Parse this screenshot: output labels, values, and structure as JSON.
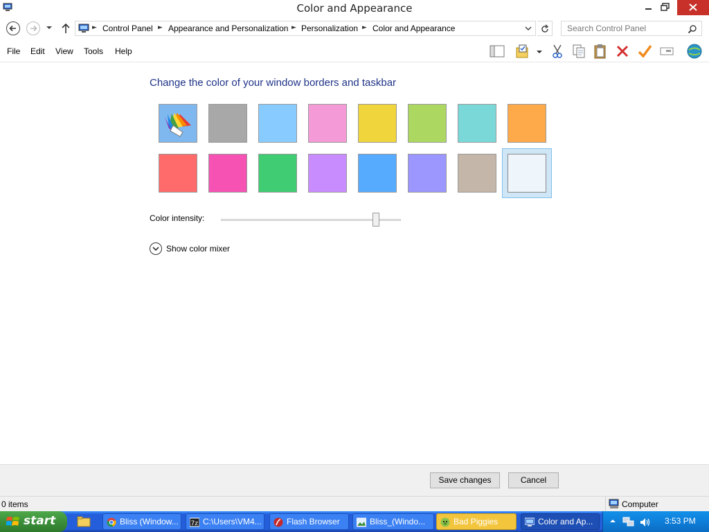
{
  "window": {
    "title": "Color and Appearance"
  },
  "address": {
    "breadcrumbs": [
      "Control Panel",
      "Appearance and Personalization",
      "Personalization",
      "Color and Appearance"
    ]
  },
  "search": {
    "placeholder": "Search Control Panel"
  },
  "menu": {
    "items": [
      "File",
      "Edit",
      "View",
      "Tools",
      "Help"
    ]
  },
  "toolbar": {
    "icons": [
      "layout-pane-icon",
      "folder-properties-icon",
      "cut-icon",
      "copy-icon",
      "paste-icon",
      "delete-icon",
      "check-icon",
      "rename-icon",
      "globe-icon"
    ]
  },
  "content": {
    "heading": "Change the color of your window borders and taskbar",
    "swatches_row1": [
      {
        "name": "automatic",
        "color": "#7fb7ef"
      },
      {
        "name": "gray",
        "color": "#a8a8a8"
      },
      {
        "name": "sky",
        "color": "#88ccff"
      },
      {
        "name": "pink",
        "color": "#f39ad7"
      },
      {
        "name": "yellow",
        "color": "#f0d53c"
      },
      {
        "name": "lime",
        "color": "#acd862"
      },
      {
        "name": "teal",
        "color": "#7ad9d8"
      },
      {
        "name": "orange",
        "color": "#ffaa4a"
      }
    ],
    "swatches_row2": [
      {
        "name": "red",
        "color": "#ff6b6b"
      },
      {
        "name": "magenta",
        "color": "#f552b3"
      },
      {
        "name": "green",
        "color": "#40cc72"
      },
      {
        "name": "violet",
        "color": "#c88cff"
      },
      {
        "name": "blue",
        "color": "#56abff"
      },
      {
        "name": "periwinkle",
        "color": "#9b97ff"
      },
      {
        "name": "taupe",
        "color": "#c4b6a8"
      },
      {
        "name": "frost",
        "color": "#eef5fb"
      }
    ],
    "selected_swatch": "frost",
    "intensity_label": "Color intensity:",
    "intensity_value": 0.86,
    "mixer_label": "Show color mixer"
  },
  "buttons": {
    "save": "Save changes",
    "cancel": "Cancel"
  },
  "status": {
    "items": "0 items",
    "location": "Computer"
  },
  "taskbar": {
    "start": "start",
    "tasks": [
      {
        "label": "Bliss (Window...",
        "icon": "chrome-icon",
        "state": "normal"
      },
      {
        "label": "C:\\Users\\VM4...",
        "icon": "sevenzip-icon",
        "state": "normal"
      },
      {
        "label": "Flash Browser",
        "icon": "flash-icon",
        "state": "normal"
      },
      {
        "label": "Bliss_(Windo...",
        "icon": "image-icon",
        "state": "normal"
      },
      {
        "label": "Bad Piggies",
        "icon": "piggy-icon",
        "state": "flash"
      },
      {
        "label": "Color and Ap...",
        "icon": "control-panel-icon",
        "state": "active"
      }
    ],
    "clock": "3:53 PM"
  }
}
